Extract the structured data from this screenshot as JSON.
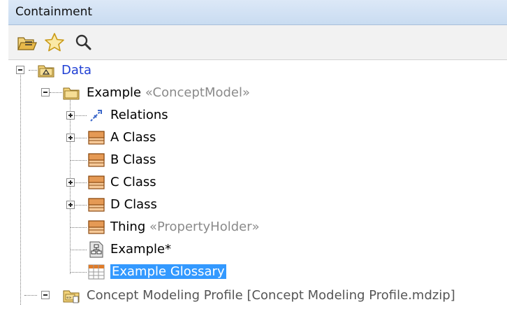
{
  "panel": {
    "title": "Containment"
  },
  "toolbar": {
    "buttons": [
      {
        "name": "open-folder-icon"
      },
      {
        "name": "star-icon"
      },
      {
        "name": "search-icon"
      }
    ]
  },
  "tree": {
    "root": {
      "label": "Data",
      "expanded": true
    },
    "example": {
      "label": "Example",
      "stereotype": "«ConceptModel»",
      "expanded": true
    },
    "children": [
      {
        "label": "Relations",
        "stereotype": "",
        "expander": "plus",
        "icon": "relations-icon"
      },
      {
        "label": "A Class",
        "stereotype": "",
        "expander": "plus",
        "icon": "class-icon"
      },
      {
        "label": "B Class",
        "stereotype": "",
        "expander": "none",
        "icon": "class-icon"
      },
      {
        "label": "C Class",
        "stereotype": "",
        "expander": "plus",
        "icon": "class-icon"
      },
      {
        "label": "D Class",
        "stereotype": "",
        "expander": "plus",
        "icon": "class-icon"
      },
      {
        "label": "Thing",
        "stereotype": "«PropertyHolder»",
        "expander": "none",
        "icon": "class-icon"
      },
      {
        "label": "Example*",
        "stereotype": "",
        "expander": "none",
        "icon": "diagram-icon"
      },
      {
        "label": "Example Glossary",
        "stereotype": "",
        "expander": "none",
        "icon": "glossary-table-icon",
        "selected": true
      }
    ],
    "profile": {
      "label": "Concept Modeling Profile [Concept Modeling Profile.mdzip]",
      "expander": "plus",
      "icon": "profile-package-icon"
    }
  },
  "colors": {
    "header": "#c9dcf1",
    "selection": "#3399ff",
    "root_label": "#1f3fd4"
  }
}
